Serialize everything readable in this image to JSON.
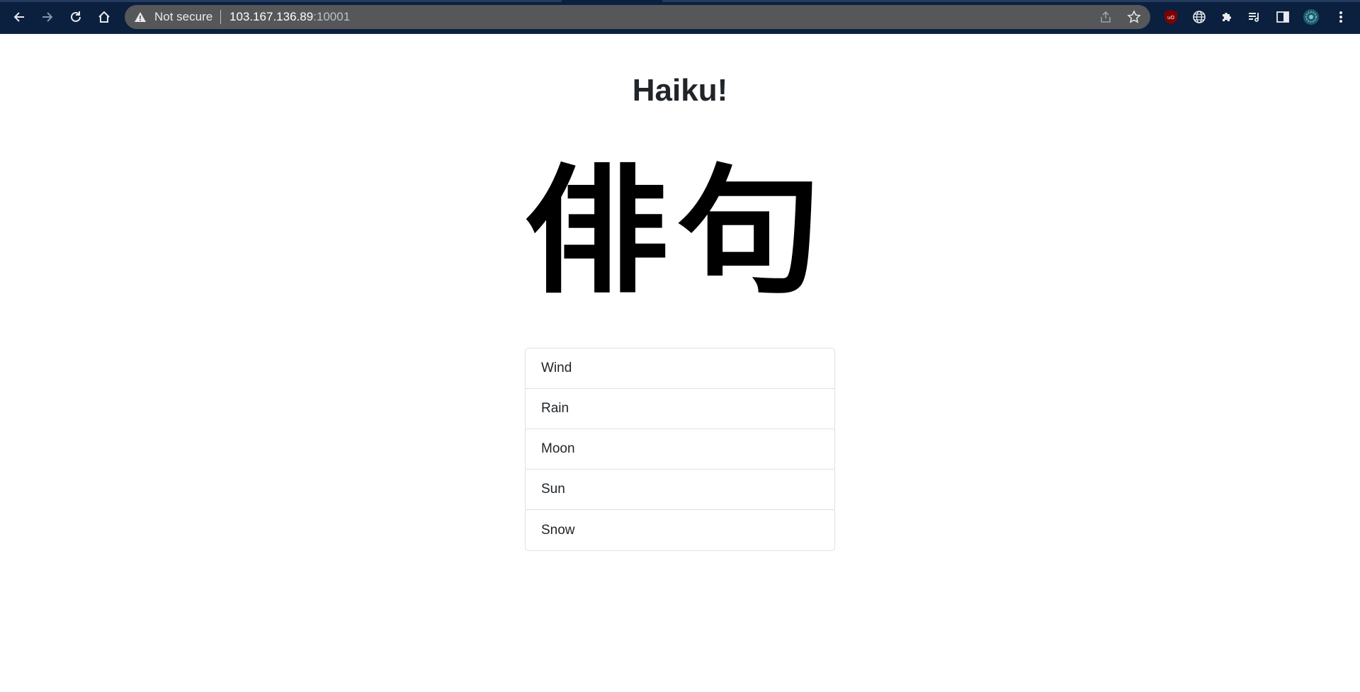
{
  "browser": {
    "security_label": "Not secure",
    "url_host": "103.167.136.89",
    "url_port": ":10001",
    "icons": {
      "back": "arrow-left-icon",
      "forward": "arrow-right-icon",
      "reload": "reload-icon",
      "home": "home-icon",
      "warning": "warning-triangle-icon",
      "share": "share-icon",
      "bookmark": "star-icon",
      "ublock": "ublock-origin-icon",
      "translate": "globe-icon",
      "extensions": "puzzle-icon",
      "reading_list": "reading-list-icon",
      "side_panel": "side-panel-icon",
      "profile": "profile-avatar-icon",
      "menu": "kebab-menu-icon"
    },
    "colors": {
      "toolbar": "#0b1f3e",
      "omnibox": "#555759"
    }
  },
  "page": {
    "title": "Haiku!",
    "logo_text": "俳句",
    "list_items": [
      "Wind",
      "Rain",
      "Moon",
      "Sun",
      "Snow"
    ]
  }
}
